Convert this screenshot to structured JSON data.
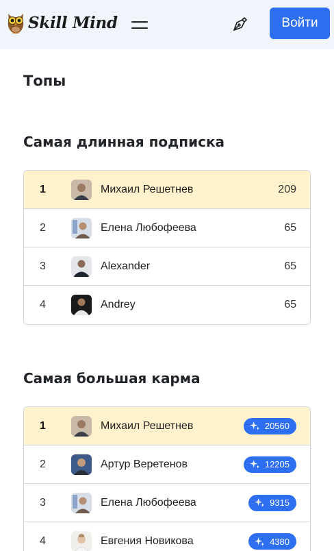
{
  "header": {
    "brand": "Skill Mind",
    "login_label": "Войти",
    "icons": {
      "logo": "owl-logo-icon",
      "menu": "hamburger-menu-icon",
      "write": "pen-nib-icon"
    }
  },
  "page": {
    "title": "Топы"
  },
  "longest_subscription": {
    "title": "Самая длинная подписка",
    "rows": [
      {
        "rank": "1",
        "name": "Михаил Решетнев",
        "value": "209"
      },
      {
        "rank": "2",
        "name": "Елена Любофеева",
        "value": "65"
      },
      {
        "rank": "3",
        "name": "Alexander",
        "value": "65"
      },
      {
        "rank": "4",
        "name": "Andrey",
        "value": "65"
      }
    ]
  },
  "biggest_karma": {
    "title": "Самая большая карма",
    "rows": [
      {
        "rank": "1",
        "name": "Михаил Решетнев",
        "value": "20560"
      },
      {
        "rank": "2",
        "name": "Артур Веретенов",
        "value": "12205"
      },
      {
        "rank": "3",
        "name": "Елена Любофеева",
        "value": "9315"
      },
      {
        "rank": "4",
        "name": "Евгения Новикова",
        "value": "4380"
      }
    ]
  },
  "colors": {
    "accent": "#2d6ff0",
    "highlight_row": "#fff2cc",
    "topbar": "#f0f4fb"
  }
}
